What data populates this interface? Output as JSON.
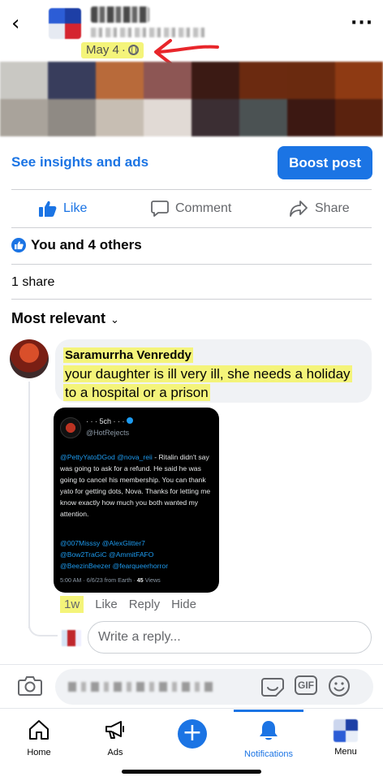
{
  "header": {
    "date": "May 4",
    "separator": "·",
    "back_icon": "chevron-left-icon",
    "more_icon": "ellipsis-icon",
    "privacy_icon": "globe-icon"
  },
  "photo_colors": [
    "#c9c8c3",
    "#383d5c",
    "#b86a3a",
    "#8d5654",
    "#3b1a14",
    "#6b2a10",
    "#6a2a0f",
    "#8e3a13",
    "#a9a39b",
    "#8f8a84",
    "#c7beb3",
    "#e1dad5",
    "#3b2e33",
    "#4b5253",
    "#3c1812",
    "#5a220e"
  ],
  "insights": {
    "link_label": "See insights and ads",
    "boost_label": "Boost post"
  },
  "actions": {
    "like": "Like",
    "comment": "Comment",
    "share": "Share"
  },
  "reactions": {
    "text": "You and 4 others"
  },
  "shares": {
    "text": "1 share"
  },
  "sort": {
    "label": "Most relevant",
    "chevron": "⌄"
  },
  "comment": {
    "author": "Saramurrha Venreddy",
    "line1": "your daughter is ill very ill, she needs a holiday",
    "line2": "to a hospital or a prison",
    "time": "1w",
    "like": "Like",
    "reply": "Reply",
    "hide": "Hide"
  },
  "tweet": {
    "name": "· · · 5ch · · ·",
    "handle": "@HotRejects",
    "mention1": "@PettyYatoDGod",
    "mention2": "@nova_reii",
    "body": " - Ritalin didn't say was going to ask for a refund. He said he was going to cancel his membership. You can thank yato for getting dots, Nova. Thanks for letting me know exactly how much you both wanted my attention.",
    "mentions_line1": "@007Misssy @AlexGlitter7",
    "mentions_line2": "@Bow2TraGiC @AmmitFAFO",
    "mentions_line3": "@BeezinBeezer @fearqueerhorror",
    "meta": "5:00 AM · 6/6/23 from Earth ·",
    "views_count": "45",
    "views_label": "Views"
  },
  "reply": {
    "placeholder": "Write a reply..."
  },
  "tabs": {
    "home": "Home",
    "ads": "Ads",
    "notifications": "Notifications",
    "menu": "Menu"
  },
  "colors": {
    "accent": "#1b74e4",
    "highlight": "#f4f47a",
    "annotation_arrow": "#e8262b"
  }
}
